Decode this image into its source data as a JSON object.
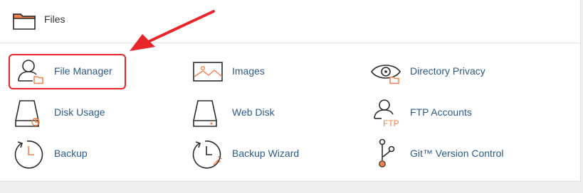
{
  "section": {
    "title": "Files",
    "icon": "folder-icon"
  },
  "items": [
    {
      "label": "File Manager",
      "icon": "file-manager-icon"
    },
    {
      "label": "Images",
      "icon": "images-icon"
    },
    {
      "label": "Directory Privacy",
      "icon": "directory-privacy-icon"
    },
    {
      "label": "Disk Usage",
      "icon": "disk-usage-icon"
    },
    {
      "label": "Web Disk",
      "icon": "web-disk-icon"
    },
    {
      "label": "FTP Accounts",
      "icon": "ftp-accounts-icon",
      "badge": "FTP"
    },
    {
      "label": "Backup",
      "icon": "backup-icon"
    },
    {
      "label": "Backup Wizard",
      "icon": "backup-wizard-icon"
    },
    {
      "label": "Git™ Version Control",
      "icon": "git-icon"
    }
  ],
  "colors": {
    "accent": "#f0814d",
    "label": "#2d5a8a",
    "annotation": "#e8252b",
    "icon_stroke": "#2b2b2b"
  },
  "annotation": {
    "target": "File Manager",
    "type": "red-arrow-and-box"
  }
}
